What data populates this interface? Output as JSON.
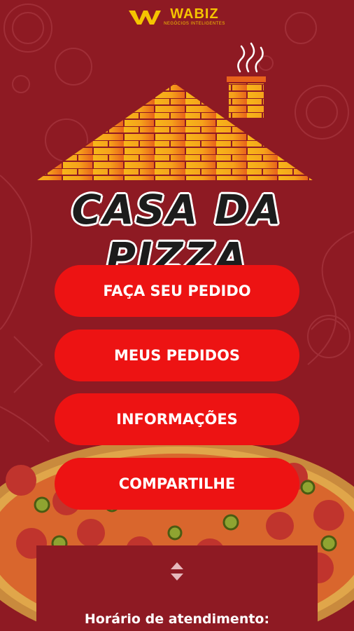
{
  "brand": {
    "name": "WABIZ",
    "tagline": "NEGÓCIOS INTELIGENTES",
    "colors": {
      "brand": "#f5c400",
      "background": "#8e1a23",
      "button": "#ed1313"
    }
  },
  "title": "CASA DA PIZZA",
  "menu": {
    "buttons": [
      {
        "label": "FAÇA SEU PEDIDO"
      },
      {
        "label": "MEUS PEDIDOS"
      },
      {
        "label": "INFORMAÇÕES"
      },
      {
        "label": "COMPARTILHE"
      }
    ]
  },
  "hours": {
    "title": "Horário de atendimento:",
    "toggle_icon": "up-down-arrows-icon"
  }
}
